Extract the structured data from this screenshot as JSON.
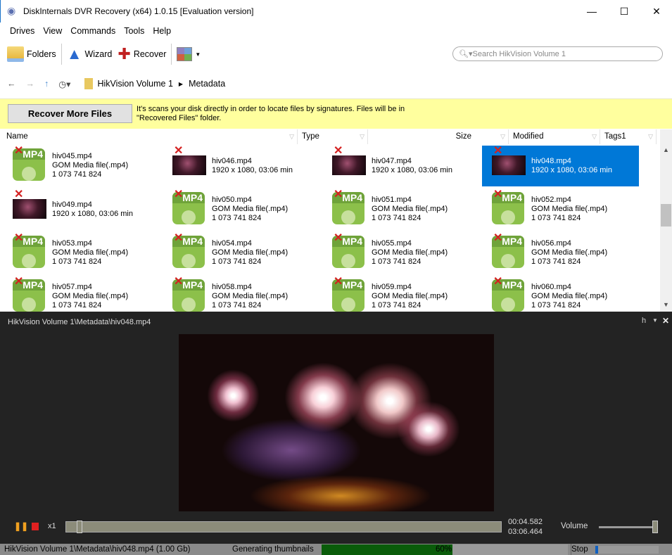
{
  "window": {
    "title": "DiskInternals DVR Recovery (x64) 1.0.15 [Evaluation version]",
    "minimize": "—",
    "maximize": "☐",
    "close": "✕"
  },
  "menu": [
    "Drives",
    "View",
    "Commands",
    "Tools",
    "Help"
  ],
  "toolbar": {
    "folders": "Folders",
    "wizard": "Wizard",
    "recover": "Recover"
  },
  "search": {
    "placeholder": "Search HikVision Volume 1"
  },
  "breadcrumb": [
    "HikVision Volume 1",
    "Metadata"
  ],
  "info": {
    "button": "Recover More Files",
    "text1": "It's scans your disk directly in order to locate files by signatures. Files will be in",
    "text2": "\"Recovered Files\" folder."
  },
  "columns": [
    "Name",
    "Type",
    "Size",
    "Modified",
    "Tags1"
  ],
  "files": [
    {
      "name": "hiv045.mp4",
      "kind": "icon",
      "l2": "GOM Media file(.mp4)",
      "l3": "1 073 741 824"
    },
    {
      "name": "hiv046.mp4",
      "kind": "thumb",
      "l2": "1920 x 1080, 03:06 min"
    },
    {
      "name": "hiv047.mp4",
      "kind": "thumb",
      "l2": "1920 x 1080, 03:06 min"
    },
    {
      "name": "hiv048.mp4",
      "kind": "thumb",
      "l2": "1920 x 1080, 03:06 min",
      "selected": true
    },
    {
      "name": "hiv049.mp4",
      "kind": "thumb",
      "l2": "1920 x 1080, 03:06 min"
    },
    {
      "name": "hiv050.mp4",
      "kind": "icon",
      "l2": "GOM Media file(.mp4)",
      "l3": "1 073 741 824"
    },
    {
      "name": "hiv051.mp4",
      "kind": "icon",
      "l2": "GOM Media file(.mp4)",
      "l3": "1 073 741 824"
    },
    {
      "name": "hiv052.mp4",
      "kind": "icon",
      "l2": "GOM Media file(.mp4)",
      "l3": "1 073 741 824"
    },
    {
      "name": "hiv053.mp4",
      "kind": "icon",
      "l2": "GOM Media file(.mp4)",
      "l3": "1 073 741 824"
    },
    {
      "name": "hiv054.mp4",
      "kind": "icon",
      "l2": "GOM Media file(.mp4)",
      "l3": "1 073 741 824"
    },
    {
      "name": "hiv055.mp4",
      "kind": "icon",
      "l2": "GOM Media file(.mp4)",
      "l3": "1 073 741 824"
    },
    {
      "name": "hiv056.mp4",
      "kind": "icon",
      "l2": "GOM Media file(.mp4)",
      "l3": "1 073 741 824"
    },
    {
      "name": "hiv057.mp4",
      "kind": "icon",
      "l2": "GOM Media file(.mp4)",
      "l3": "1 073 741 824"
    },
    {
      "name": "hiv058.mp4",
      "kind": "icon",
      "l2": "GOM Media file(.mp4)",
      "l3": "1 073 741 824"
    },
    {
      "name": "hiv059.mp4",
      "kind": "icon",
      "l2": "GOM Media file(.mp4)",
      "l3": "1 073 741 824"
    },
    {
      "name": "hiv060.mp4",
      "kind": "icon",
      "l2": "GOM Media file(.mp4)",
      "l3": "1 073 741 824"
    }
  ],
  "mp4_label": "MP4",
  "player": {
    "path": "HikVision Volume 1\\Metadata\\hiv048.mp4",
    "h": "h",
    "speed": "x1",
    "position": "00:04.582",
    "duration": "03:06.464",
    "volume_label": "Volume",
    "seek_fraction": 0.025,
    "volume_fraction": 1.0
  },
  "status": {
    "path": "HikVision Volume 1\\Metadata\\hiv048.mp4 (1.00 Gb)",
    "task": "Generating thumbnails",
    "progress": 60,
    "progress_label": "60%",
    "stop": "Stop"
  },
  "colors": {
    "accent": "#0078d7",
    "info_bg": "#ffff9e",
    "progress": "#0a5c0a"
  }
}
